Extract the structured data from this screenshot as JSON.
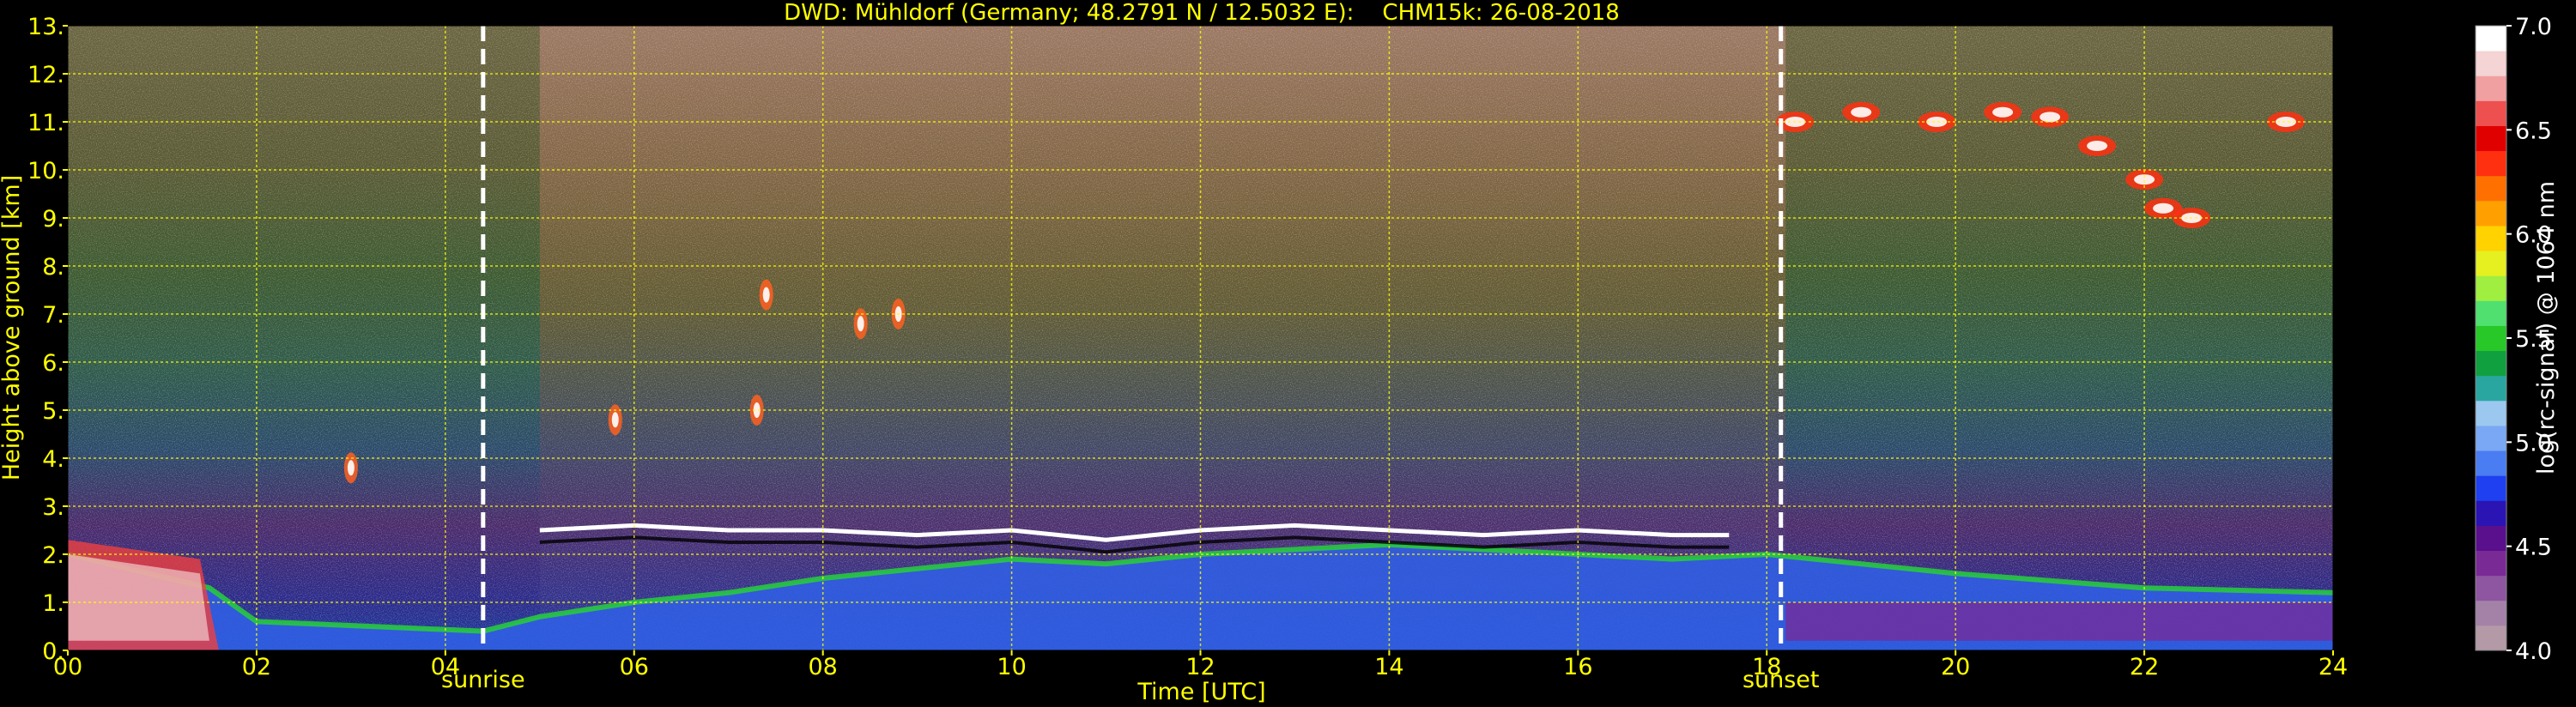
{
  "chart_data": {
    "type": "heatmap",
    "title": "DWD: Mühldorf (Germany; 48.2791 N / 12.5032 E):    CHM15k: 26-08-2018",
    "xlabel": "Time [UTC]",
    "ylabel": "Height above ground [km]",
    "colorbar_label": "log(rc-signal) @ 1064 nm",
    "xlim": [
      0,
      24
    ],
    "ylim": [
      0,
      13
    ],
    "x_ticks": [
      0,
      2,
      4,
      6,
      8,
      10,
      12,
      14,
      16,
      18,
      20,
      22,
      24
    ],
    "x_tick_labels": [
      "00",
      "02",
      "04",
      "06",
      "08",
      "10",
      "12",
      "14",
      "16",
      "18",
      "20",
      "22",
      "24"
    ],
    "y_ticks": [
      0,
      1,
      2,
      3,
      4,
      5,
      6,
      7,
      8,
      9,
      10,
      11,
      12,
      13
    ],
    "y_tick_labels": [
      "0.",
      "1.",
      "2.",
      "3.",
      "4.",
      "5.",
      "6.",
      "7.",
      "8.",
      "9.",
      "10.",
      "11.",
      "12.",
      "13."
    ],
    "grid": true,
    "colorbar": {
      "range": [
        4.0,
        7.0
      ],
      "ticks": [
        4.0,
        4.5,
        5.0,
        5.5,
        6.0,
        6.5,
        7.0
      ],
      "tick_labels": [
        "4.0",
        "4.5",
        "5.0",
        "5.5",
        "6.0",
        "6.5",
        "7.0"
      ],
      "colors": [
        "#b49aa6",
        "#a482a8",
        "#8e55a0",
        "#7a2a95",
        "#5a0f8c",
        "#2a14b4",
        "#1f40f0",
        "#4a7cf2",
        "#7aa8f4",
        "#9cc8f0",
        "#2aa6a0",
        "#10a040",
        "#28c828",
        "#50e070",
        "#a0ee40",
        "#e6f020",
        "#ffd200",
        "#ffa000",
        "#ff7000",
        "#ff3010",
        "#e00000",
        "#ee5050",
        "#f0a0a0",
        "#f4d4d4",
        "#ffffff"
      ]
    },
    "sunrise": 4.4,
    "sunrise_label": "sunrise",
    "sunset": 18.15,
    "sunset_label": "sunset",
    "features": {
      "boundary_layer_top_km": [
        [
          0.0,
          2.0
        ],
        [
          1.5,
          1.3
        ],
        [
          2.0,
          0.6
        ],
        [
          4.4,
          0.4
        ],
        [
          5.0,
          0.7
        ],
        [
          6.0,
          1.0
        ],
        [
          7.0,
          1.2
        ],
        [
          8.0,
          1.5
        ],
        [
          9.0,
          1.7
        ],
        [
          10.0,
          1.9
        ],
        [
          11.0,
          1.8
        ],
        [
          12.0,
          2.0
        ],
        [
          13.0,
          2.1
        ],
        [
          14.0,
          2.2
        ],
        [
          15.0,
          2.1
        ],
        [
          16.0,
          2.0
        ],
        [
          17.0,
          1.9
        ],
        [
          18.0,
          2.0
        ],
        [
          19.0,
          1.8
        ],
        [
          20.0,
          1.6
        ],
        [
          22.0,
          1.3
        ],
        [
          24.0,
          1.2
        ]
      ],
      "stratocumulus_top_km": [
        [
          5.0,
          2.5
        ],
        [
          6.0,
          2.6
        ],
        [
          7.0,
          2.5
        ],
        [
          8.0,
          2.5
        ],
        [
          9.0,
          2.4
        ],
        [
          10.0,
          2.5
        ],
        [
          11.0,
          2.3
        ],
        [
          12.0,
          2.5
        ],
        [
          13.0,
          2.6
        ],
        [
          14.0,
          2.5
        ],
        [
          15.0,
          2.4
        ],
        [
          16.0,
          2.5
        ],
        [
          17.0,
          2.4
        ],
        [
          17.6,
          2.4
        ]
      ],
      "cirrus_km": [
        [
          18.3,
          11.0
        ],
        [
          19.0,
          11.2
        ],
        [
          19.8,
          11.0
        ],
        [
          20.5,
          11.2
        ],
        [
          21.0,
          11.1
        ],
        [
          21.5,
          10.5
        ],
        [
          22.0,
          9.8
        ],
        [
          22.2,
          9.2
        ],
        [
          22.5,
          9.0
        ],
        [
          23.5,
          11.0
        ]
      ],
      "midlevel_clouds_km": [
        [
          5.8,
          4.8
        ],
        [
          7.3,
          5.0
        ],
        [
          7.4,
          7.4
        ],
        [
          8.4,
          6.8
        ],
        [
          8.8,
          7.0
        ],
        [
          3.0,
          3.8
        ]
      ]
    }
  }
}
